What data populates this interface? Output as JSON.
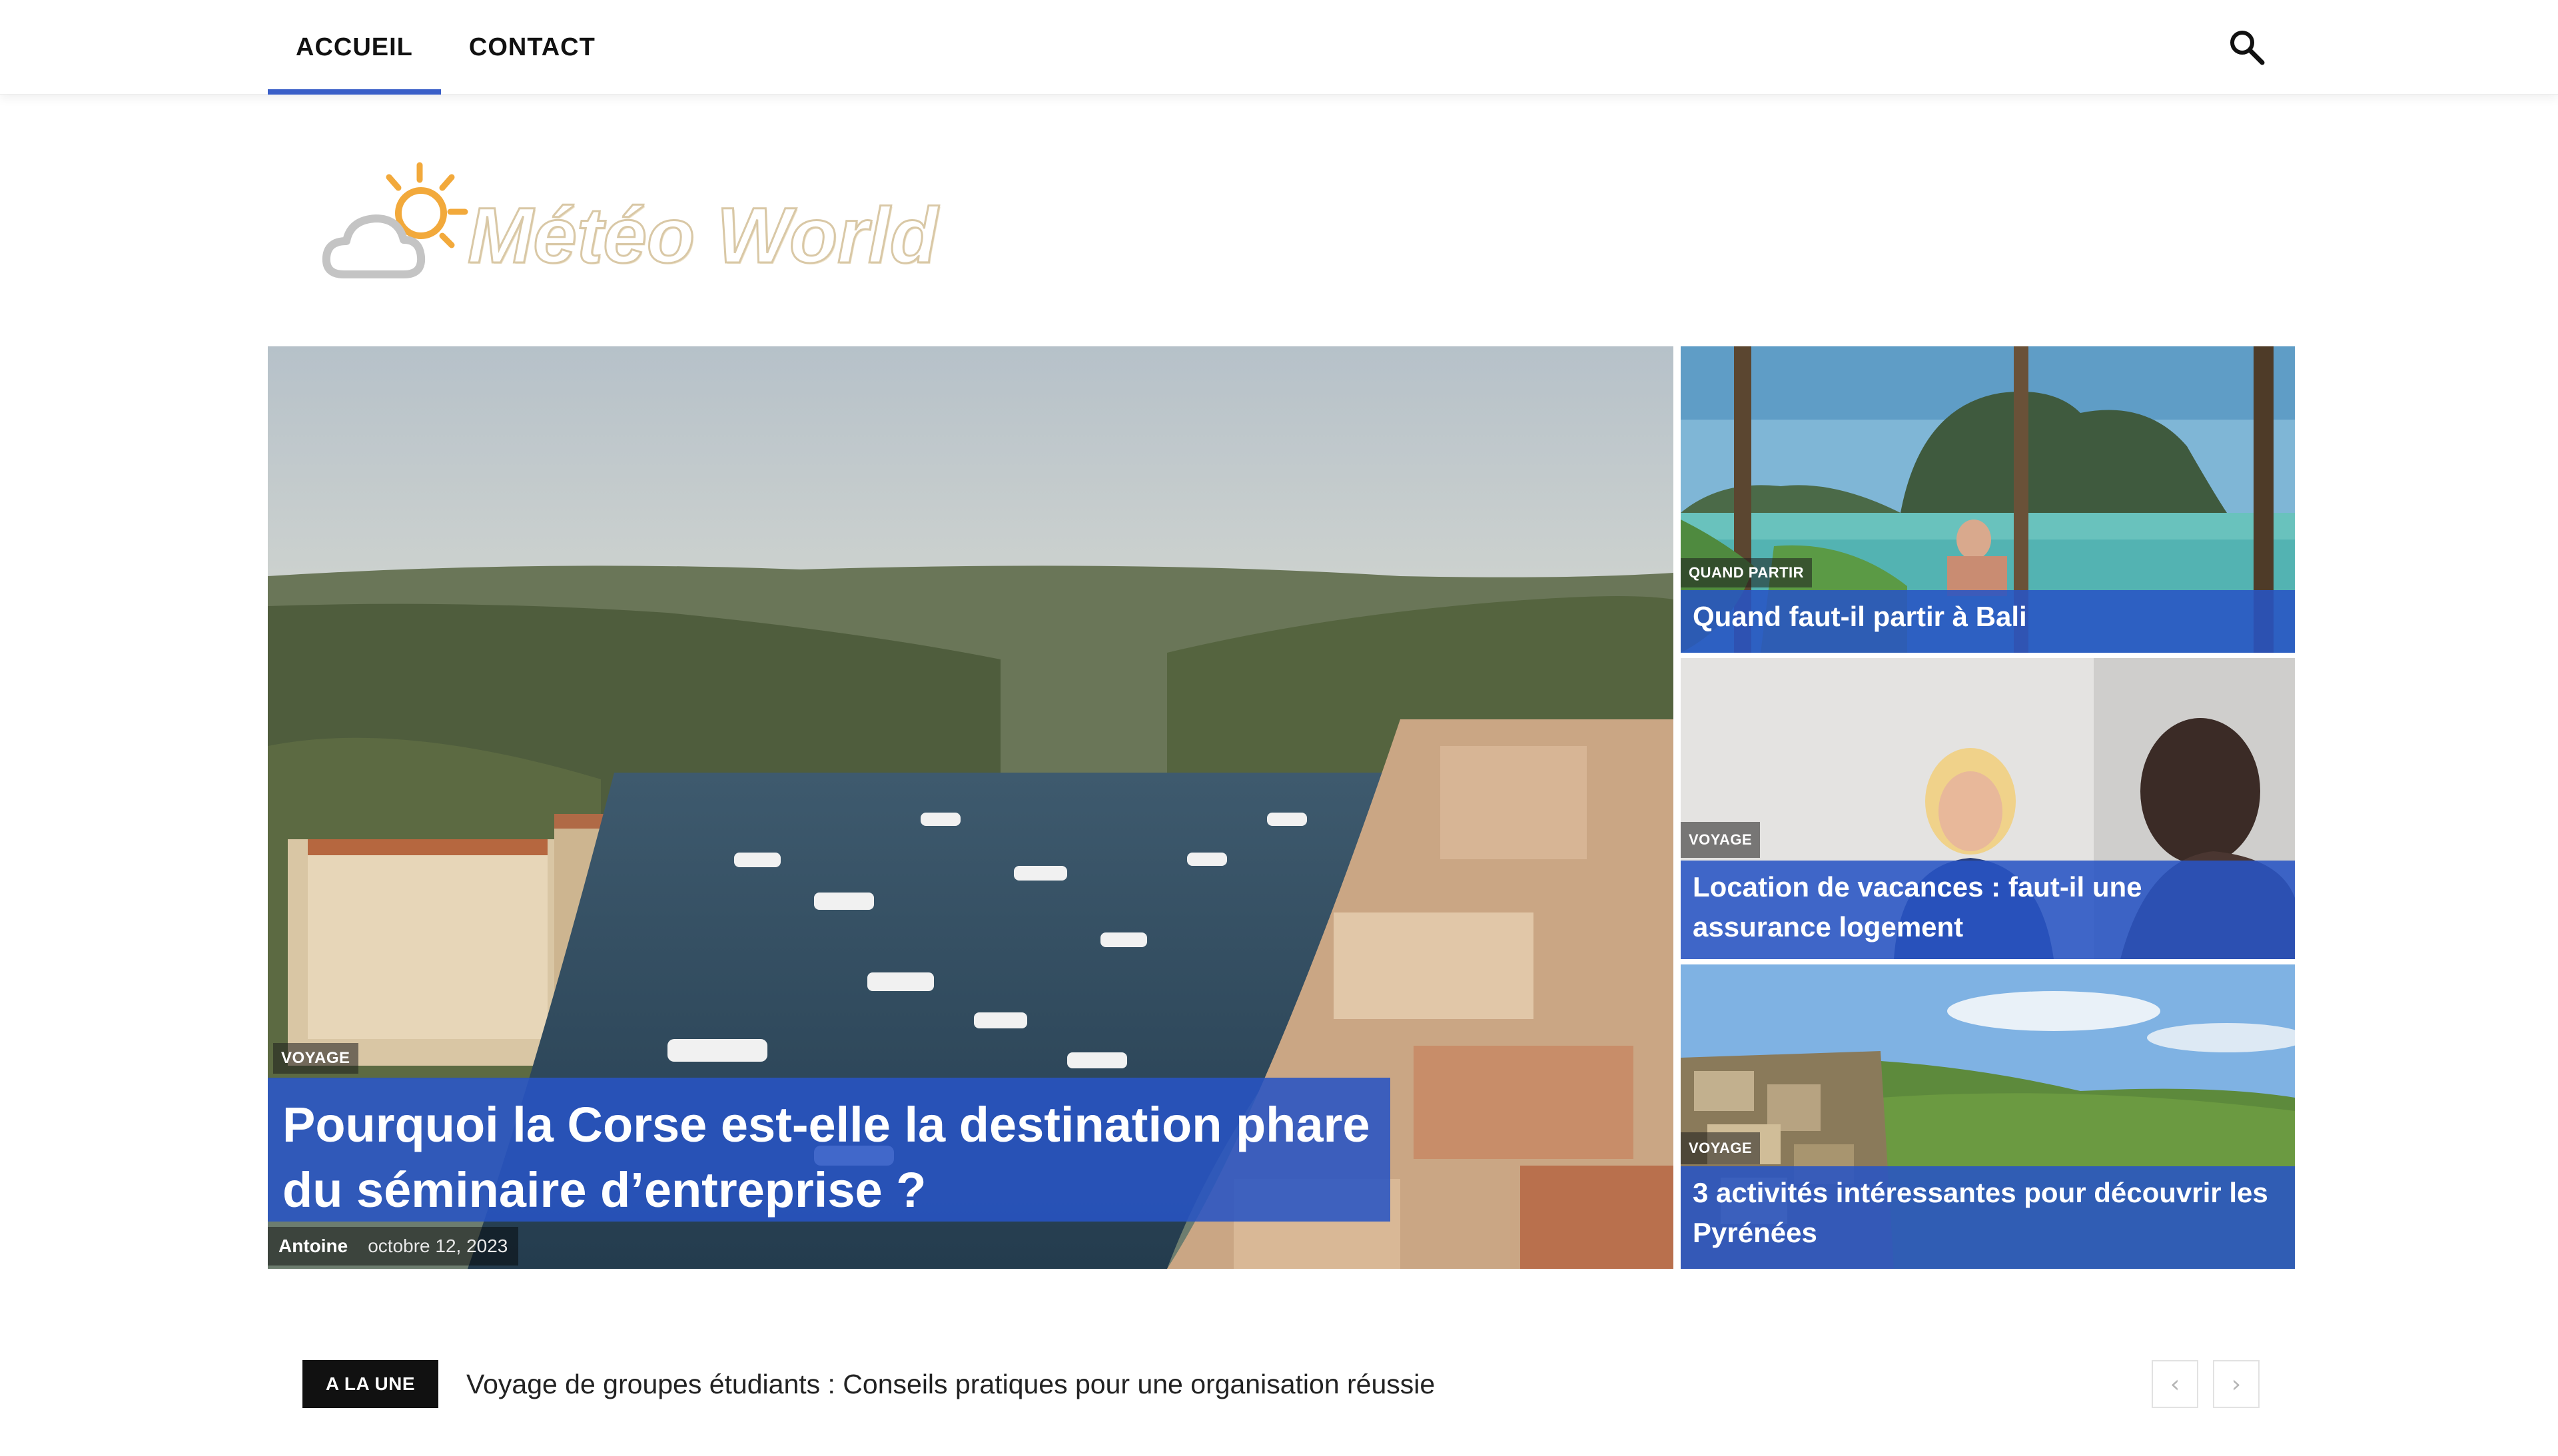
{
  "nav": {
    "items": [
      {
        "label": "ACCUEIL",
        "active": true
      },
      {
        "label": "CONTACT",
        "active": false
      }
    ],
    "search_icon": "search-icon"
  },
  "logo": {
    "text": "Météo World",
    "icon": "sun-cloud-icon",
    "colors": {
      "sun": "#f2a93b",
      "cloud": "#c4c4c4"
    }
  },
  "hero": {
    "main": {
      "category": "VOYAGE",
      "title": "Pourquoi la Corse est-elle la destination phare du séminaire d’entreprise ?",
      "author": "Antoine",
      "date": "octobre 12, 2023"
    },
    "side": [
      {
        "category": "QUAND PARTIR",
        "title": "Quand faut-il partir à Bali"
      },
      {
        "category": "VOYAGE",
        "title": "Location de vacances : faut-il une assurance logement"
      },
      {
        "category": "VOYAGE",
        "title": "3 activités intéressantes pour découvrir les Pyrénées"
      }
    ]
  },
  "ticker": {
    "badge": "A LA UNE",
    "headline": "Voyage de groupes étudiants : Conseils pratiques pour une organisation réussie",
    "prev_symbol": "‹",
    "next_symbol": "›"
  },
  "colors": {
    "accent": "#3a5fc8",
    "title_overlay": "#2854c4",
    "ticker_badge": "#111111"
  }
}
